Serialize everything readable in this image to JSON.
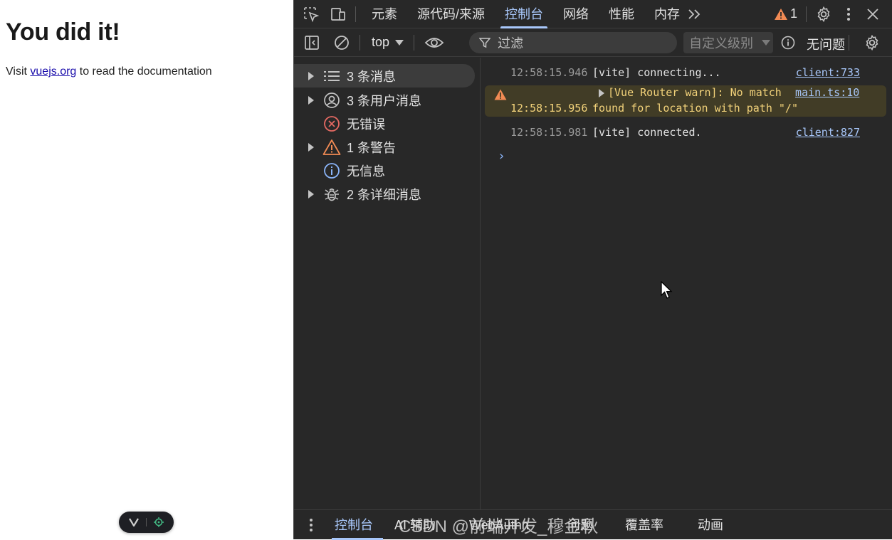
{
  "page": {
    "heading": "You did it!",
    "visit_text": "Visit ",
    "link_text": "vuejs.org",
    "after_link_text": " to read the documentation"
  },
  "devtools": {
    "tabs": [
      "元素",
      "源代码/来源",
      "控制台",
      "网络",
      "性能",
      "内存"
    ],
    "active_tab": "控制台",
    "warning_count": "1",
    "context": "top",
    "filter_placeholder": "过滤",
    "level_label": "自定义级别",
    "issues_label": "无问题",
    "sidebar": [
      {
        "label": "3 条消息",
        "icon": "list-icon"
      },
      {
        "label": "3 条用户消息",
        "icon": "user-icon"
      },
      {
        "label": "无错误",
        "icon": "error-icon"
      },
      {
        "label": "1 条警告",
        "icon": "warning-icon"
      },
      {
        "label": "无信息",
        "icon": "info-icon"
      },
      {
        "label": "2 条详细消息",
        "icon": "bug-icon"
      }
    ],
    "messages": [
      {
        "time": "12:58:15.946",
        "text": "[vite] connecting...",
        "source": "client:733",
        "level": "log"
      },
      {
        "time": "12:58:15.956",
        "text_line1": "[Vue Router warn]: No match",
        "text_line2": "found for location with path \"/\"",
        "source": "main.ts:10",
        "level": "warning"
      },
      {
        "time": "12:58:15.981",
        "text": "[vite] connected.",
        "source": "client:827",
        "level": "log"
      }
    ],
    "prompt": "›",
    "drawer_tabs": [
      "控制台",
      "AI 辅助",
      "WebAuthn",
      "问题",
      "覆盖率",
      "动画"
    ],
    "drawer_active": "控制台"
  },
  "watermark": "CSDN @前端开发_穆金秋",
  "colors": {
    "accent": "#a8c7fa",
    "warning": "#f28b54",
    "error": "#e46962",
    "panel_bg": "#282828"
  }
}
